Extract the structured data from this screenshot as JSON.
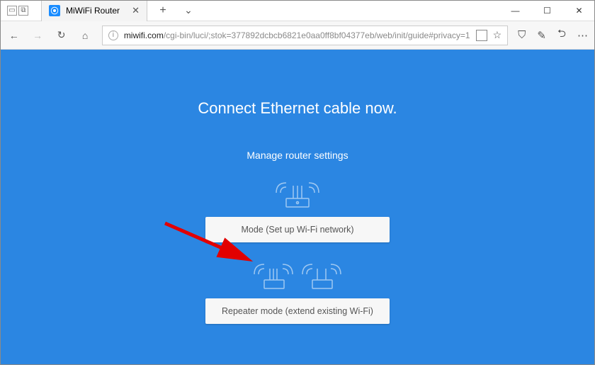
{
  "window": {
    "tab_title": "MiWiFi Router"
  },
  "toolbar": {
    "url_host": "miwifi.com",
    "url_rest": "/cgi-bin/luci/;stok=377892dcbcb6821e0aa0ff8bf04377eb/web/init/guide#privacy=1"
  },
  "page": {
    "headline": "Connect Ethernet cable now.",
    "subhead": "Manage router settings",
    "option1_label": "Mode (Set up Wi-Fi network)",
    "option2_label": "Repeater mode (extend existing Wi-Fi)"
  }
}
